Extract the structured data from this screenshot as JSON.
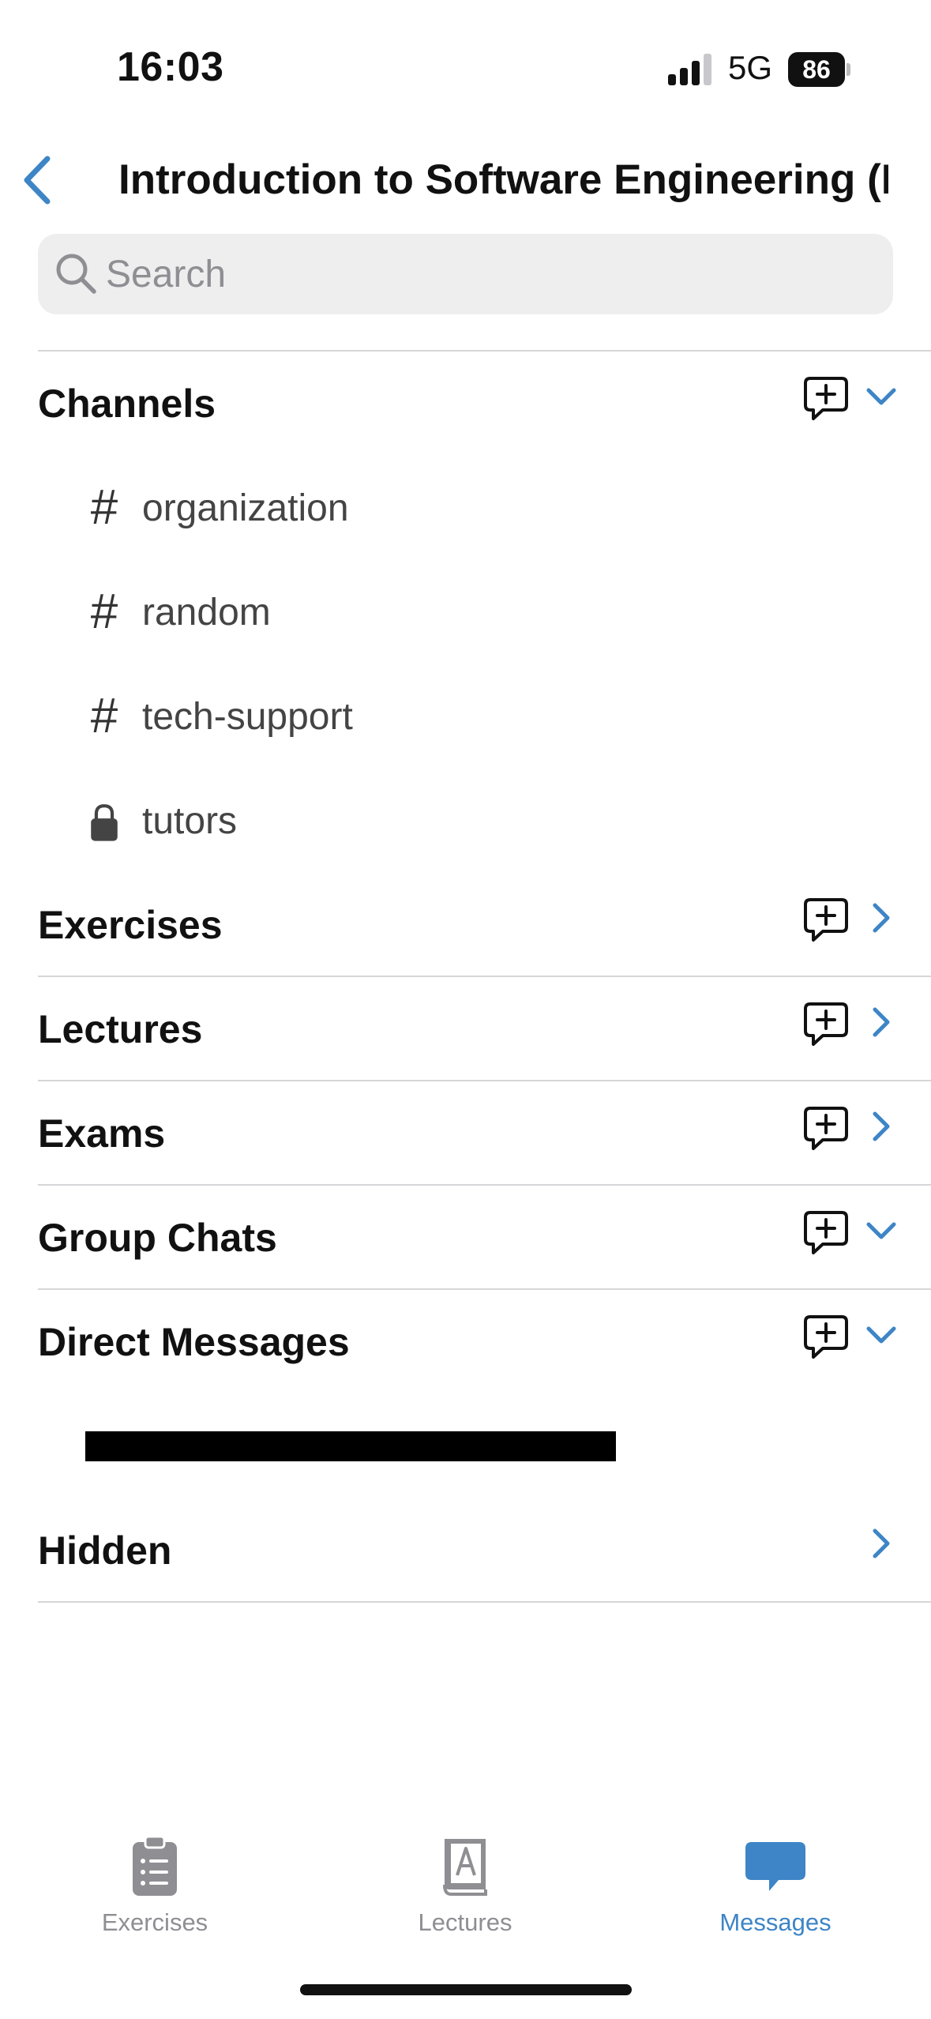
{
  "status_bar": {
    "time": "16:03",
    "network": "5G",
    "battery": "86"
  },
  "nav": {
    "title": "Introduction to Software Engineering (I..."
  },
  "search": {
    "placeholder": "Search"
  },
  "sections": {
    "channels": "Channels",
    "exercises": "Exercises",
    "lectures": "Lectures",
    "exams": "Exams",
    "group_chats": "Group Chats",
    "direct_messages": "Direct Messages",
    "hidden": "Hidden"
  },
  "channels": [
    {
      "name": "organization",
      "icon": "hash-icon"
    },
    {
      "name": "random",
      "icon": "hash-icon"
    },
    {
      "name": "tech-support",
      "icon": "hash-icon"
    },
    {
      "name": "tutors",
      "icon": "lock-icon"
    }
  ],
  "tabs": [
    {
      "label": "Exercises",
      "icon": "clipboard-icon",
      "active": false
    },
    {
      "label": "Lectures",
      "icon": "book-icon",
      "active": false
    },
    {
      "label": "Messages",
      "icon": "message-bubble-icon",
      "active": true
    }
  ],
  "colors": {
    "accent": "#3d85c6",
    "separator": "#d6d6d8",
    "search_bg": "#eeeeef",
    "inactive": "#8e8e93"
  }
}
